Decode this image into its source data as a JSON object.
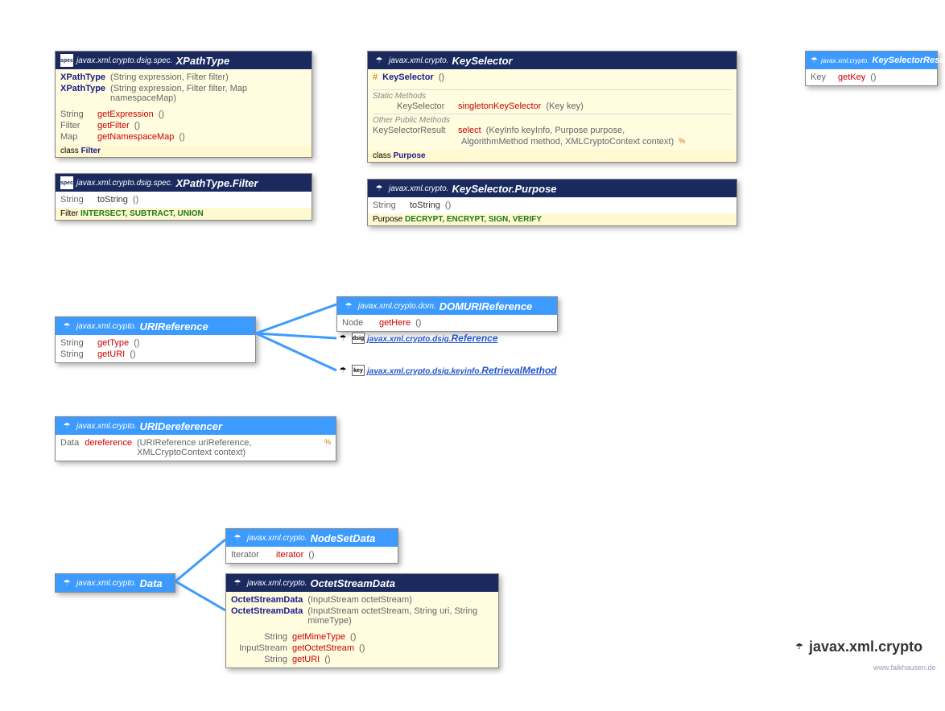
{
  "xpathtype": {
    "pkg": "javax.xml.crypto.dsig.spec.",
    "name": "XPathType",
    "icon_label": "spec",
    "ctor1_name": "XPathType",
    "ctor1_params": " (String expression, Filter filter)",
    "ctor2_name": "XPathType",
    "ctor2_params": " (String expression, Filter filter, Map namespaceMap)",
    "m1_ret": "String",
    "m1": "getExpression",
    "m1_p": " ()",
    "m2_ret": "Filter",
    "m2": "getFilter",
    "m2_p": " ()",
    "m3_ret": "Map",
    "m3": "getNamespaceMap",
    "m3_p": " ()",
    "footer_kw": "class ",
    "footer_val": "Filter"
  },
  "xpathtype_filter": {
    "pkg": "javax.xml.crypto.dsig.spec.",
    "name": "XPathType.Filter",
    "icon_label": "spec",
    "m1_ret": "String",
    "m1": "toString",
    "m1_p": " ()",
    "footer_kw": "Filter ",
    "footer_vals": "INTERSECT, SUBTRACT, UNION"
  },
  "keyselector": {
    "pkg": "javax.xml.crypto.",
    "name": "KeySelector",
    "ctor_prefix": "#",
    "ctor_name": "KeySelector",
    "ctor_params": " ()",
    "sec1": "Static Methods",
    "s1_ret": "KeySelector",
    "s1": "singletonKeySelector",
    "s1_p": " (Key key)",
    "sec2": "Other Public Methods",
    "m1_ret": "KeySelectorResult",
    "m1": "select",
    "m1_p1": " (KeyInfo keyInfo, Purpose purpose,",
    "m1_p2": "AlgorithmMethod method, XMLCryptoContext context) ",
    "m1_throws": "%",
    "footer_kw": "class ",
    "footer_val": "Purpose"
  },
  "keyselector_purpose": {
    "pkg": "javax.xml.crypto.",
    "name": "KeySelector.Purpose",
    "m1_ret": "String",
    "m1": "toString",
    "m1_p": " ()",
    "footer_kw": "Purpose ",
    "footer_vals": "DECRYPT, ENCRYPT, SIGN, VERIFY"
  },
  "keyselectorresult": {
    "pkg": "javax.xml.crypto.",
    "name": "KeySelectorResult",
    "m1_ret": "Key",
    "m1": "getKey",
    "m1_p": " ()"
  },
  "urireference": {
    "pkg": "javax.xml.crypto.",
    "name": "URIReference",
    "m1_ret": "String",
    "m1": "getType",
    "m1_p": " ()",
    "m2_ret": "String",
    "m2": "getURI",
    "m2_p": " ()"
  },
  "domurireference": {
    "pkg": "javax.xml.crypto.dom.",
    "name": "DOMURIReference",
    "m1_ret": "Node",
    "m1": "getHere",
    "m1_p": " ()"
  },
  "ref_reference": {
    "pkg": "javax.xml.crypto.dsig.",
    "name": "Reference",
    "icon_label": "dsig"
  },
  "ref_retrieval": {
    "pkg": "javax.xml.crypto.dsig.keyinfo.",
    "name": "RetrievalMethod",
    "icon_label": "key"
  },
  "uridereferencer": {
    "pkg": "javax.xml.crypto.",
    "name": "URIDereferencer",
    "m1_ret": "Data",
    "m1": "dereference",
    "m1_p": " (URIReference uriReference, XMLCryptoContext context) ",
    "m1_throws": "%"
  },
  "data": {
    "pkg": "javax.xml.crypto.",
    "name": "Data"
  },
  "nodesetdata": {
    "pkg": "javax.xml.crypto.",
    "name": "NodeSetData",
    "m1_ret": "Iterator",
    "m1": "iterator",
    "m1_p": " ()"
  },
  "octetstreamdata": {
    "pkg": "javax.xml.crypto.",
    "name": "OctetStreamData",
    "ctor1_name": "OctetStreamData",
    "ctor1_params": " (InputStream octetStream)",
    "ctor2_name": "OctetStreamData",
    "ctor2_params": " (InputStream octetStream, String uri, String mimeType)",
    "m1_ret": "String",
    "m1": "getMimeType",
    "m1_p": " ()",
    "m2_ret": "InputStream",
    "m2": "getOctetStream",
    "m2_p": " ()",
    "m3_ret": "String",
    "m3": "getURI",
    "m3_p": " ()"
  },
  "title": "javax.xml.crypto",
  "watermark": "www.falkhausen.de"
}
